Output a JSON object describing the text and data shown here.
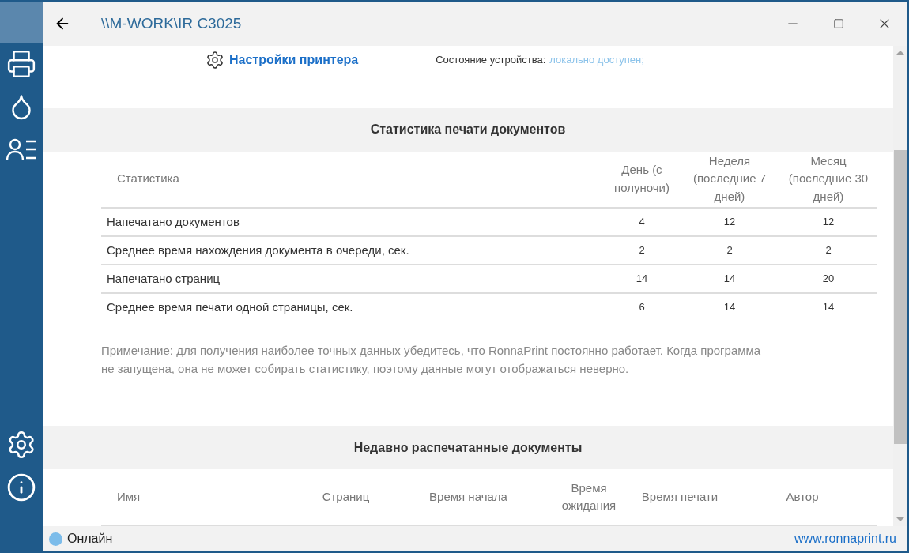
{
  "window": {
    "title": "\\\\M-WORK\\IR C3025"
  },
  "header": {
    "settings_link": "Настройки принтера",
    "status_label": "Состояние устройства:",
    "status_value": "локально доступен;"
  },
  "stats": {
    "title": "Статистика печати документов",
    "columns": [
      "Статистика",
      "День (с полуночи)",
      "Неделя (последние 7 дней)",
      "Месяц (последние 30 дней)"
    ],
    "rows": [
      {
        "name": "Напечатано документов",
        "day": "4",
        "week": "12",
        "month": "12"
      },
      {
        "name": "Среднее время нахождения документа в очереди, сек.",
        "day": "2",
        "week": "2",
        "month": "2"
      },
      {
        "name": "Напечатано страниц",
        "day": "14",
        "week": "14",
        "month": "20"
      },
      {
        "name": "Среднее время печати одной страницы, сек.",
        "day": "6",
        "week": "14",
        "month": "14"
      }
    ],
    "note": "Примечание: для получения наиболее точных данных убедитесь, что RonnaPrint постоянно работает. Когда программа не запущена, она не может собирать статистику, поэтому данные могут отображаться неверно."
  },
  "recent": {
    "title": "Недавно распечатанные документы",
    "columns": [
      "Имя",
      "Страниц",
      "Время начала",
      "Время ожидания",
      "Время печати",
      "Автор"
    ]
  },
  "status_bar": {
    "state": "Онлайн",
    "color": "#7cbcea",
    "link": "www.ronnaprint.ru"
  }
}
